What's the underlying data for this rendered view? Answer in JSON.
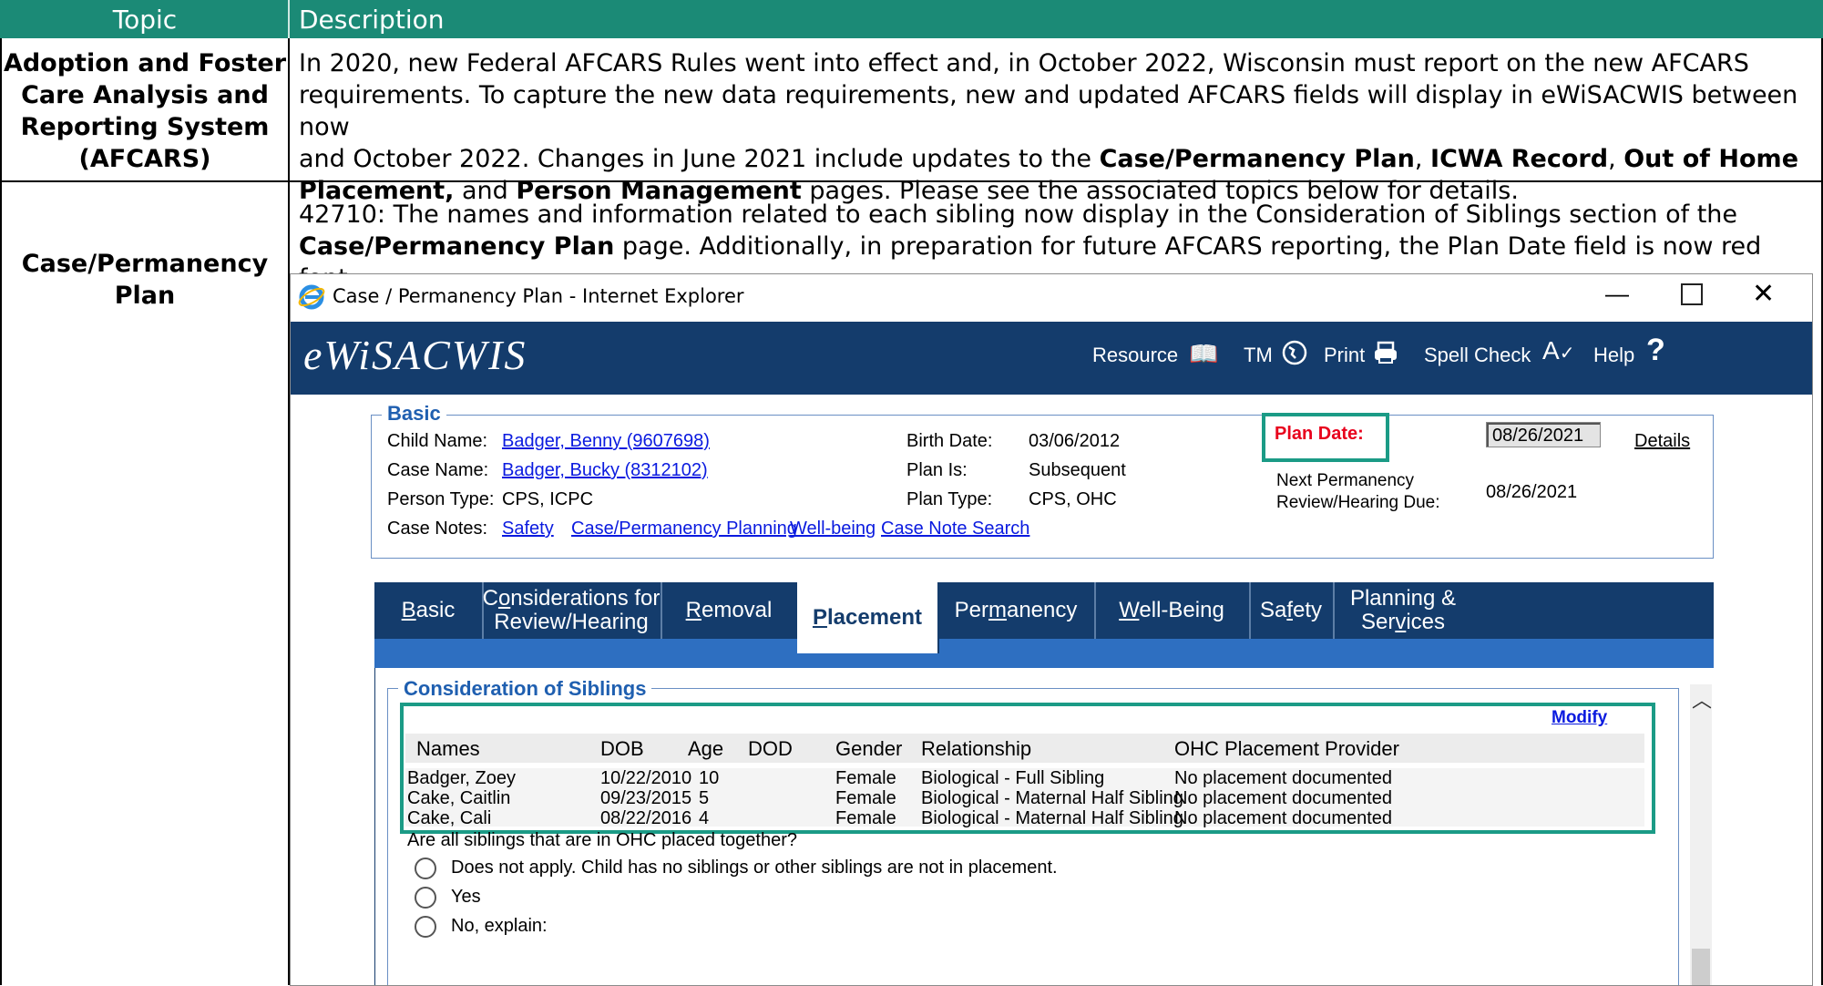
{
  "table": {
    "headers": [
      "Topic",
      "Description"
    ],
    "rows": [
      {
        "topic_lines": [
          "Adoption and Foster",
          "Care Analysis and",
          "Reporting System",
          "(AFCARS)"
        ],
        "description": {
          "l1": "In 2020, new Federal AFCARS Rules went into effect and, in October 2022, Wisconsin must report on the new AFCARS",
          "l2": "requirements. To capture the new data requirements, new and updated AFCARS fields will display in eWiSACWIS between now",
          "l3a": "and October 2022. Changes in June 2021 include updates to the ",
          "l3b": "Case/Permanency Plan",
          "l3c": ", ",
          "l3d": "ICWA Record",
          "l3e": ", ",
          "l3f": "Out of Home",
          "l4a": "Placement,",
          "l4b": " and ",
          "l4c": "Person Management",
          "l4d": " pages. Please see the associated topics below for details."
        }
      },
      {
        "topic_lines": [
          "Case/Permanency",
          "Plan"
        ],
        "description": {
          "l1": "42710: The names and information related to each sibling now display in the Consideration of Siblings section of the",
          "l2a": "Case/Permanency Plan",
          "l2b": " page. Additionally, in preparation for future AFCARS reporting, the Plan Date field is now red font."
        }
      }
    ]
  },
  "window": {
    "title": "Case / Permanency Plan - Internet Explorer",
    "app_name": "eWiSACWIS",
    "nav": {
      "resource": "Resource",
      "tm": "TM",
      "print": "Print",
      "spell_check": "Spell Check",
      "help": "Help"
    },
    "basic": {
      "legend": "Basic",
      "child_name_label": "Child Name:",
      "child_name": "Badger, Benny  (9607698)",
      "case_name_label": "Case Name:",
      "case_name": "Badger, Bucky  (8312102)",
      "person_type_label": "Person Type:",
      "person_type": "CPS, ICPC",
      "case_notes_label": "Case Notes:",
      "case_notes_links": [
        "Safety",
        "Case/Permanency Planning",
        "Well-being",
        "Case Note Search"
      ],
      "birth_date_label": "Birth Date:",
      "birth_date": "03/06/2012",
      "plan_is_label": "Plan Is:",
      "plan_is": "Subsequent",
      "plan_type_label": "Plan Type:",
      "plan_type": "CPS, OHC",
      "plan_date_label": "Plan Date:",
      "plan_date": "08/26/2021",
      "details_link": "Details",
      "next_review_label_1": "Next Permanency",
      "next_review_label_2": "Review/Hearing Due:",
      "next_review": "08/26/2021"
    },
    "tabs": [
      {
        "pre": "",
        "u": "B",
        "post": "asic"
      },
      {
        "pre": "C",
        "u": "o",
        "post": "nsiderations for",
        "line2": "Review/Hearing"
      },
      {
        "pre": "",
        "u": "R",
        "post": "emoval"
      },
      {
        "pre": "",
        "u": "P",
        "post": "lacement"
      },
      {
        "pre": "Per",
        "u": "m",
        "post": "anency"
      },
      {
        "pre": "",
        "u": "W",
        "post": "ell-Being"
      },
      {
        "pre": "Sa",
        "u": "f",
        "post": "ety"
      },
      {
        "pre": "Planning &",
        "u": "",
        "post": "",
        "line2pre": "Ser",
        "line2u": "v",
        "line2post": "ices"
      }
    ],
    "siblings": {
      "legend": "Consideration of Siblings",
      "modify": "Modify",
      "columns": [
        "Names",
        "DOB",
        "Age",
        "DOD",
        "Gender",
        "Relationship",
        "OHC Placement Provider"
      ],
      "rows": [
        [
          "Badger, Zoey",
          "10/22/2010",
          "10",
          "",
          "Female",
          "Biological - Full Sibling",
          "No placement documented"
        ],
        [
          "Cake, Caitlin",
          "09/23/2015",
          "5",
          "",
          "Female",
          "Biological - Maternal Half Sibling",
          "No placement documented"
        ],
        [
          "Cake, Cali",
          "08/22/2016",
          "4",
          "",
          "Female",
          "Biological - Maternal Half Sibling",
          "No placement documented"
        ]
      ],
      "question": "Are all siblings that are in OHC placed together?",
      "options": [
        "Does not apply. Child has no siblings or other siblings are not in placement.",
        "Yes",
        "No, explain:"
      ]
    },
    "colors": {
      "nav": "#143c6c",
      "highlight_box": "#1b9b86",
      "plan_date_red": "#e8001c",
      "link_blue": "#0a1adf"
    }
  }
}
